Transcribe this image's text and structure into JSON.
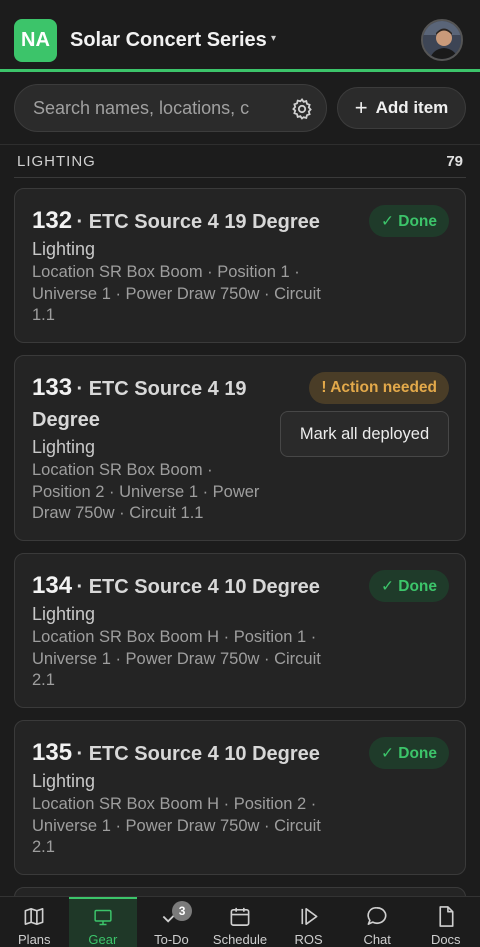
{
  "header": {
    "app_initials": "NA",
    "title": "Solar Concert Series",
    "caret": "▾"
  },
  "search": {
    "placeholder": "Search names, locations, c"
  },
  "add_button": {
    "label": "Add item"
  },
  "section": {
    "title": "LIGHTING",
    "count": "79"
  },
  "items": [
    {
      "number": "132",
      "name": "· ETC Source 4 19 Degree",
      "category": "Lighting",
      "details": [
        "Location SR Box Boom · Position 1 ·",
        "Universe 1 · Power Draw 750w · Circuit",
        "1.1"
      ],
      "status": "✓ Done"
    },
    {
      "number": "133",
      "name": "· ETC Source 4 19",
      "name_cont": "Degree",
      "category": "Lighting",
      "details": [
        "Location SR Box Boom ·",
        "Position 2 · Universe 1 · Power",
        "Draw 750w · Circuit 1.1"
      ],
      "status": "! Action needed",
      "action": "Mark all deployed"
    },
    {
      "number": "134",
      "name": "· ETC Source 4 10 Degree",
      "category": "Lighting",
      "details": [
        "Location SR Box Boom H · Position 1 ·",
        "Universe 1 · Power Draw 750w · Circuit",
        "2.1"
      ],
      "status": "✓ Done"
    },
    {
      "number": "135",
      "name": "· ETC Source 4 10 Degree",
      "category": "Lighting",
      "details": [
        "Location SR Box Boom H · Position 2 ·",
        "Universe 1 · Power Draw 750w · Circuit",
        "2.1"
      ],
      "status": "✓ Done"
    }
  ],
  "nav": {
    "plans": "Plans",
    "gear": "Gear",
    "todo": "To-Do",
    "todo_badge": "3",
    "schedule": "Schedule",
    "ros": "ROS",
    "chat": "Chat",
    "docs": "Docs"
  },
  "colors": {
    "accent": "#3cc46a",
    "warning": "#e3a94a",
    "background": "#1c1c1c"
  }
}
